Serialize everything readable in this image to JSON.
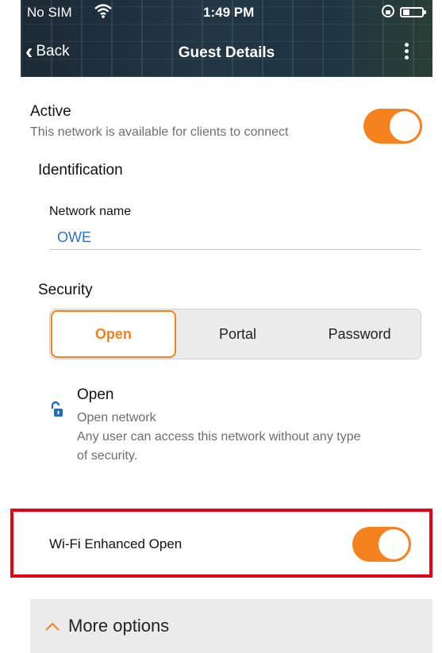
{
  "status_bar": {
    "carrier": "No SIM",
    "time": "1:49 PM"
  },
  "nav": {
    "back_label": "Back",
    "title": "Guest Details"
  },
  "active": {
    "title": "Active",
    "description": "This network is available for clients to connect",
    "enabled": true
  },
  "identification": {
    "heading": "Identification",
    "network_name_label": "Network name",
    "network_name_value": "OWE"
  },
  "security": {
    "heading": "Security",
    "options": [
      "Open",
      "Portal",
      "Password"
    ],
    "selected": "Open",
    "detail": {
      "title": "Open",
      "subtitle": "Open network",
      "body_line1": "Any user can access this network without any type",
      "body_line2": "of security."
    }
  },
  "wifi_enhanced_open": {
    "label": "Wi-Fi Enhanced Open",
    "enabled": true
  },
  "more_options": {
    "label": "More options"
  },
  "colors": {
    "accent": "#f5821f",
    "link": "#2f73b8",
    "highlight_border": "#e3000f",
    "lock_icon": "#1f6fb8"
  }
}
